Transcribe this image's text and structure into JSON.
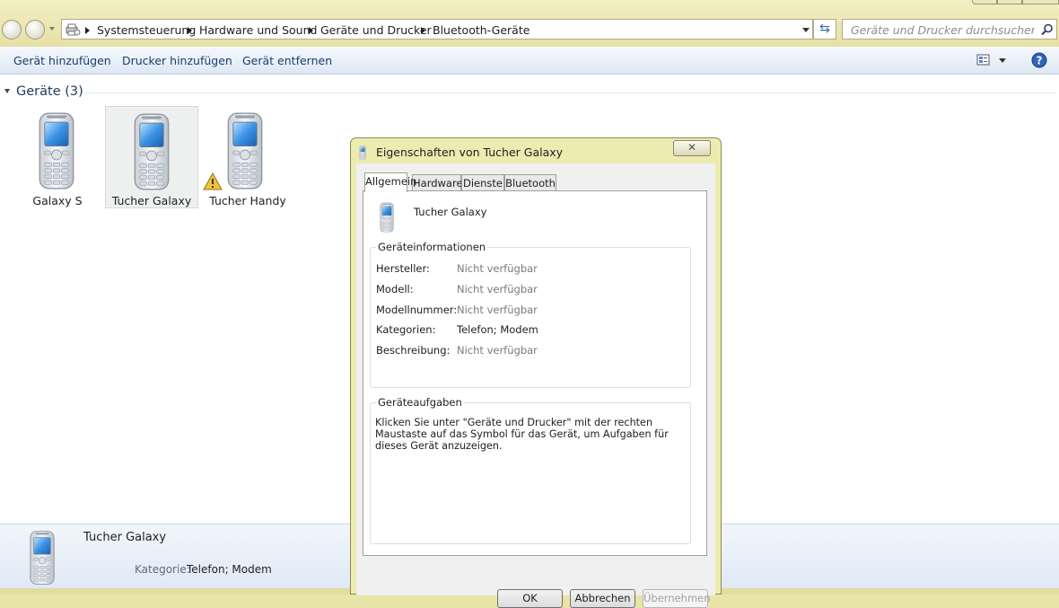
{
  "address_bar": {
    "breadcrumbs": [
      "Systemsteuerung",
      "Hardware und Sound",
      "Geräte und Drucker",
      "Bluetooth-Geräte"
    ]
  },
  "search": {
    "placeholder": "Geräte und Drucker durchsuchen"
  },
  "command_bar": {
    "add_device": "Gerät hinzufügen",
    "add_printer": "Drucker hinzufügen",
    "remove_device": "Gerät entfernen"
  },
  "group": {
    "header": "Geräte (3)"
  },
  "devices": [
    {
      "name": "Galaxy S"
    },
    {
      "name": "Tucher Galaxy"
    },
    {
      "name": "Tucher Handy"
    }
  ],
  "details_pane": {
    "device_name": "Tucher Galaxy",
    "category_label": "Kategorie:",
    "category_value": "Telefon; Modem"
  },
  "dialog": {
    "title": "Eigenschaften von Tucher Galaxy",
    "close_glyph": "✕",
    "tabs": [
      "Allgemein",
      "Hardware",
      "Dienste",
      "Bluetooth"
    ],
    "device_name": "Tucher Galaxy",
    "info_group": {
      "legend": "Geräteinformationen",
      "rows": [
        {
          "label": "Hersteller:",
          "value": "Nicht verfügbar"
        },
        {
          "label": "Modell:",
          "value": "Nicht verfügbar"
        },
        {
          "label": "Modellnummer:",
          "value": "Nicht verfügbar"
        },
        {
          "label": "Kategorien:",
          "value": "Telefon; Modem"
        },
        {
          "label": "Beschreibung:",
          "value": "Nicht verfügbar"
        }
      ]
    },
    "tasks_group": {
      "legend": "Geräteaufgaben",
      "text": "Klicken Sie unter \"Geräte und Drucker\" mit der rechten Maustaste auf das Symbol für das Gerät, um Aufgaben für dieses Gerät anzuzeigen."
    },
    "buttons": {
      "ok": "OK",
      "cancel": "Abbrechen",
      "apply": "Übernehmen"
    }
  }
}
